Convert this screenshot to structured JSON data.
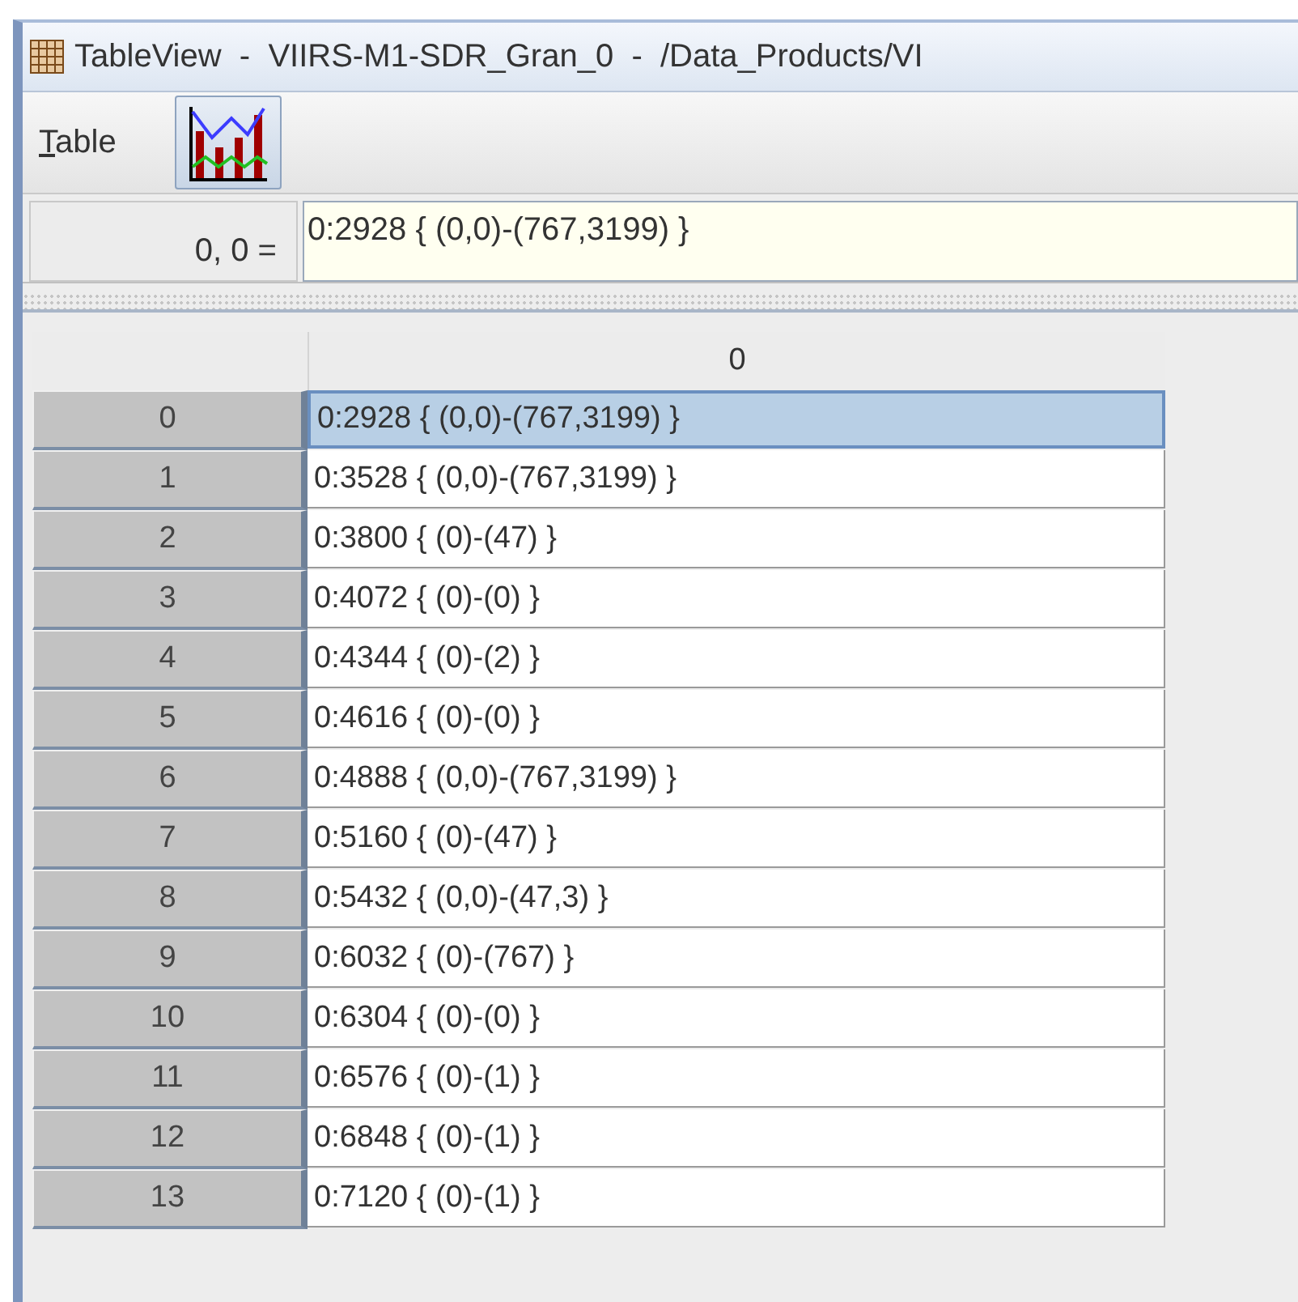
{
  "window": {
    "title": "TableView  -  VIIRS-M1-SDR_Gran_0  -  /Data_Products/VI"
  },
  "menu": [
    {
      "label": "Table"
    }
  ],
  "toolbar": [
    {
      "kind": "chart"
    }
  ],
  "cell_bar": {
    "address": "0, 0 =",
    "value": "0:2928 { (0,0)-(767,3199) }"
  },
  "table": {
    "columns": [
      "0"
    ],
    "rows": [
      {
        "header": "0",
        "value": "0:2928 { (0,0)-(767,3199) }",
        "selected": true
      },
      {
        "header": "1",
        "value": "0:3528 { (0,0)-(767,3199) }",
        "selected": false
      },
      {
        "header": "2",
        "value": "0:3800 { (0)-(47) }",
        "selected": false
      },
      {
        "header": "3",
        "value": "0:4072 { (0)-(0) }",
        "selected": false
      },
      {
        "header": "4",
        "value": "0:4344 { (0)-(2) }",
        "selected": false
      },
      {
        "header": "5",
        "value": "0:4616 { (0)-(0) }",
        "selected": false
      },
      {
        "header": "6",
        "value": "0:4888 { (0,0)-(767,3199) }",
        "selected": false
      },
      {
        "header": "7",
        "value": "0:5160 { (0)-(47) }",
        "selected": false
      },
      {
        "header": "8",
        "value": "0:5432 { (0,0)-(47,3) }",
        "selected": false
      },
      {
        "header": "9",
        "value": "0:6032 { (0)-(767) }",
        "selected": false
      },
      {
        "header": "10",
        "value": "0:6304 { (0)-(0) }",
        "selected": false
      },
      {
        "header": "11",
        "value": "0:6576 { (0)-(1) }",
        "selected": false
      },
      {
        "header": "12",
        "value": "0:6848 { (0)-(1) }",
        "selected": false
      },
      {
        "header": "13",
        "value": "0:7120 { (0)-(1) }",
        "selected": false
      }
    ]
  }
}
